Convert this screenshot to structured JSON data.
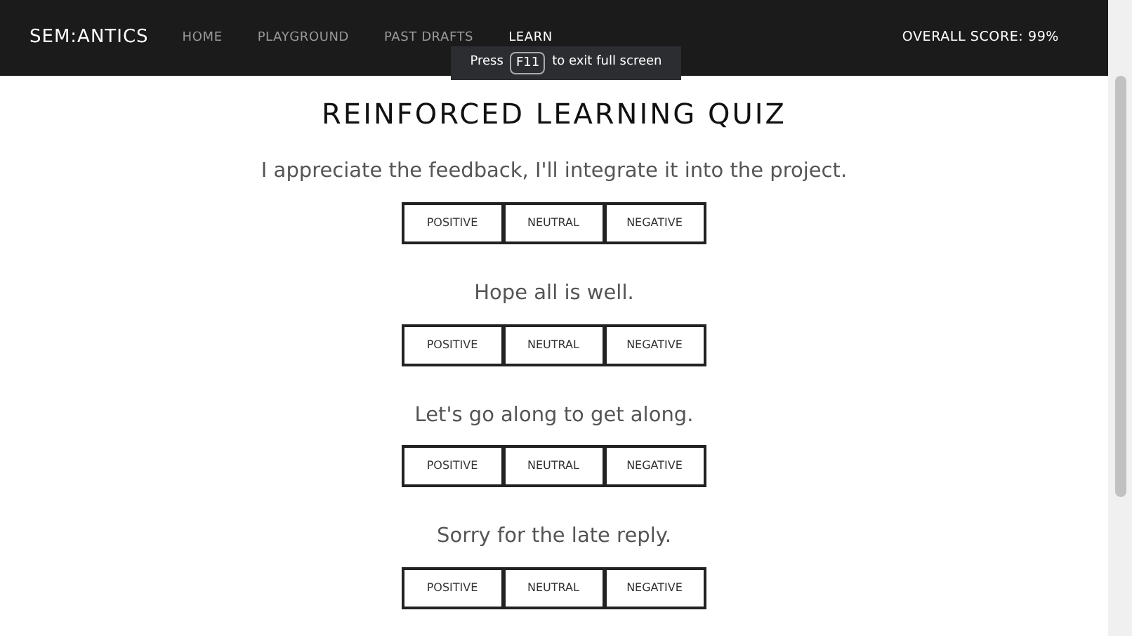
{
  "header": {
    "logo": "SEM:ANTICS",
    "nav": [
      {
        "label": "HOME",
        "selected": false
      },
      {
        "label": "PLAYGROUND",
        "selected": false
      },
      {
        "label": "PAST DRAFTS",
        "selected": false
      },
      {
        "label": "LEARN",
        "selected": true
      }
    ],
    "score": "OVERALL SCORE: 99%"
  },
  "fullscreen_notice": {
    "before": "Press",
    "key": "F11",
    "after": "to exit full screen"
  },
  "title": "REINFORCED LEARNING QUIZ",
  "questions": [
    {
      "text": "I appreciate the feedback, I'll integrate it into the project.",
      "options": [
        "POSITIVE",
        "NEUTRAL",
        "NEGATIVE"
      ]
    },
    {
      "text": "Hope all is well.",
      "options": [
        "POSITIVE",
        "NEUTRAL",
        "NEGATIVE"
      ]
    },
    {
      "text": "Let's go along to get along.",
      "options": [
        "POSITIVE",
        "NEUTRAL",
        "NEGATIVE"
      ]
    },
    {
      "text": "Sorry for the late reply.",
      "options": [
        "POSITIVE",
        "NEUTRAL",
        "NEGATIVE"
      ]
    }
  ]
}
